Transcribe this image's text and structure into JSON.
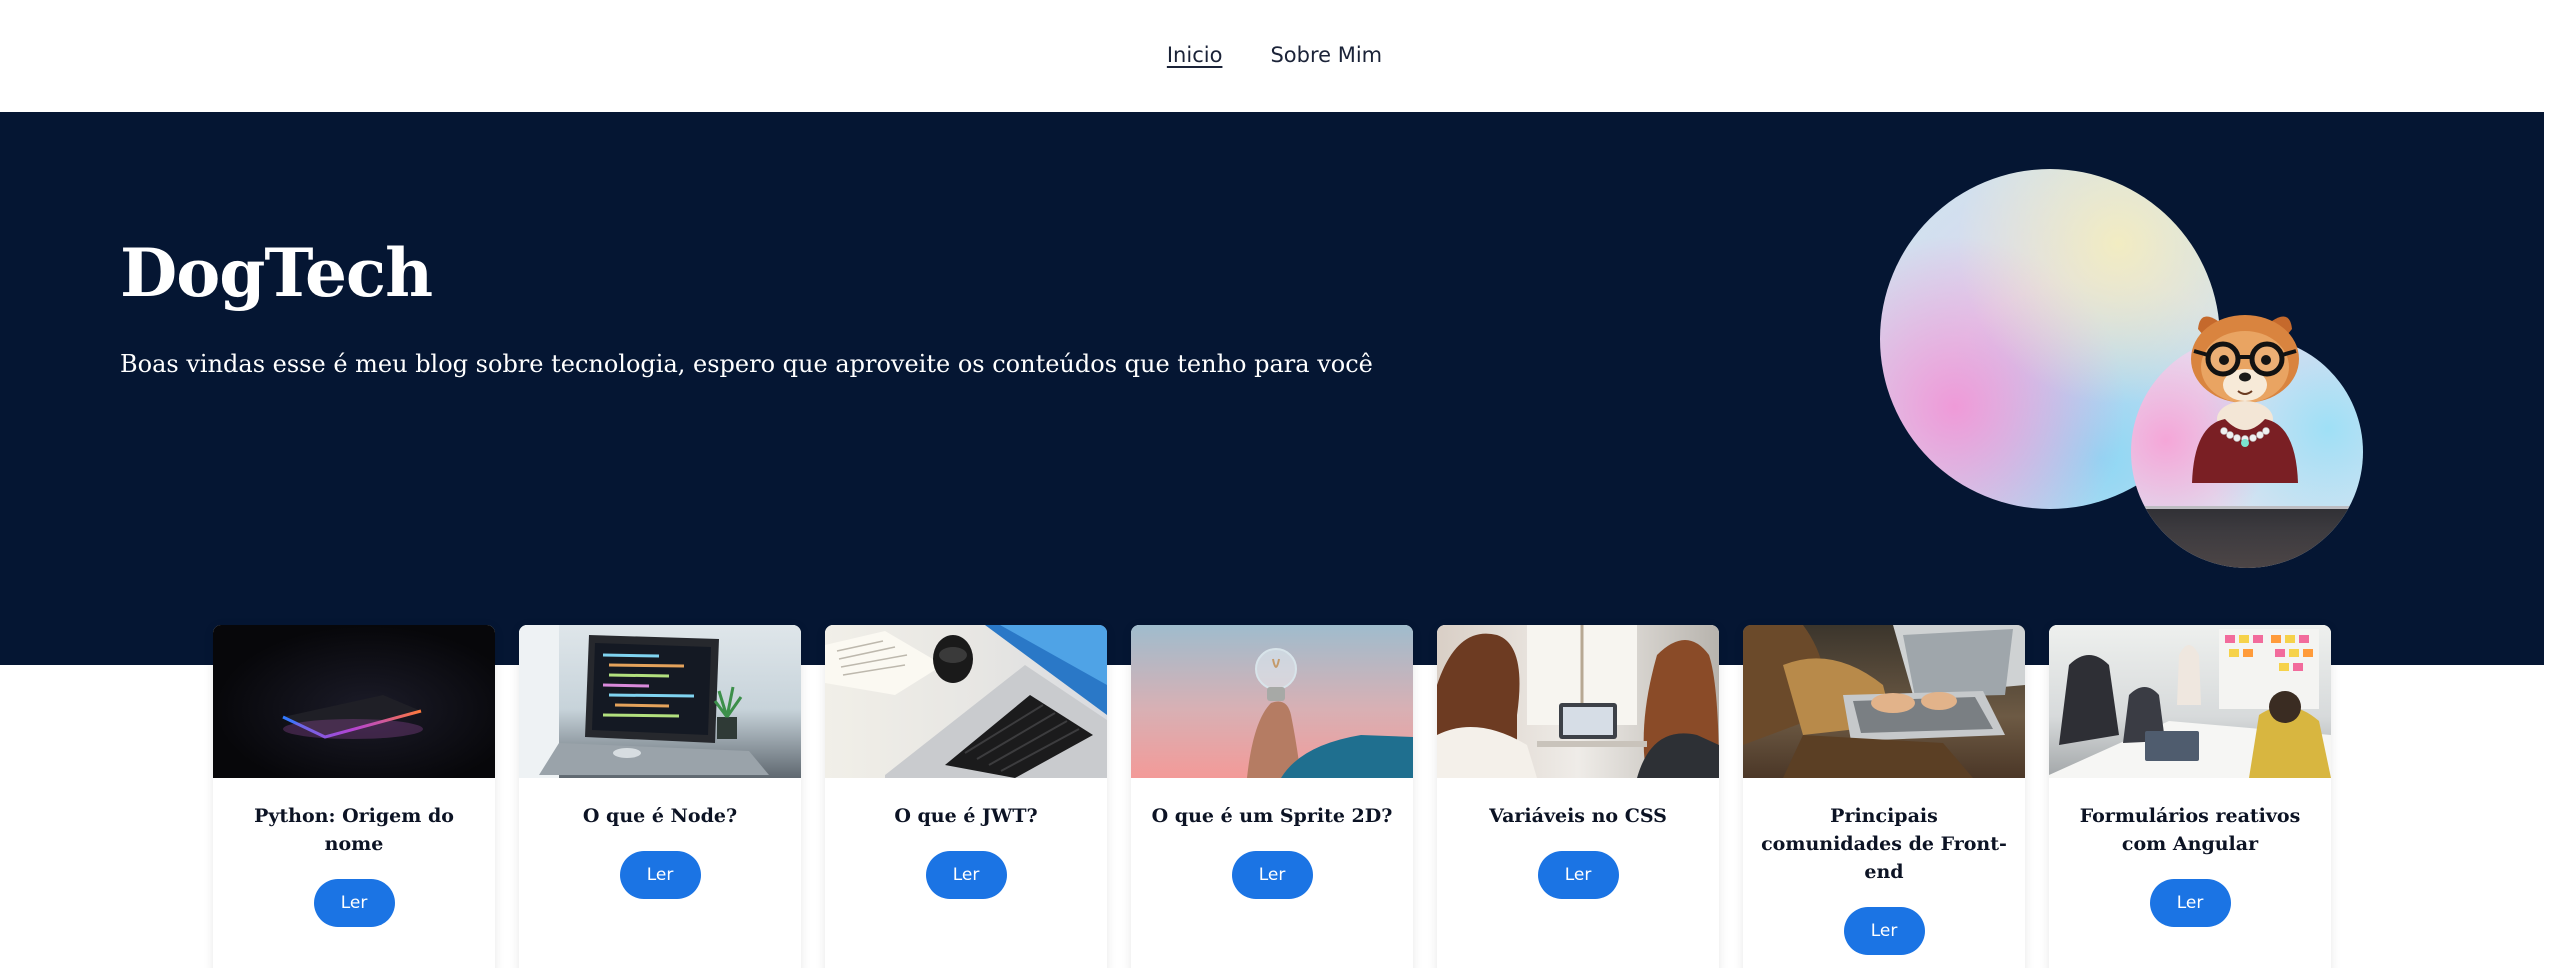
{
  "nav": {
    "items": [
      {
        "label": "Inicio",
        "active": true
      },
      {
        "label": "Sobre Mim",
        "active": false
      }
    ]
  },
  "hero": {
    "title": "DogTech",
    "subtitle": "Boas vindas esse é meu blog sobre tecnologia, espero que aproveite os conteúdos que tenho para você"
  },
  "colors": {
    "hero_background": "#051633",
    "button": "#1b74e4",
    "text_dark": "#0c1324"
  },
  "cards": [
    {
      "title": "Python: Origem do nome",
      "button": "Ler",
      "image": "laptop-neon-photo"
    },
    {
      "title": "O que é Node?",
      "button": "Ler",
      "image": "laptop-code-photo"
    },
    {
      "title": "O que é JWT?",
      "button": "Ler",
      "image": "laptop-desk-photo"
    },
    {
      "title": "O que é um Sprite 2D?",
      "button": "Ler",
      "image": "lightbulb-photo"
    },
    {
      "title": "Variáveis no CSS",
      "button": "Ler",
      "image": "women-laptop-photo"
    },
    {
      "title": "Principais comunidades de Front-end",
      "button": "Ler",
      "image": "typing-laptop-photo"
    },
    {
      "title": "Formulários reativos com Angular",
      "button": "Ler",
      "image": "team-meeting-photo"
    }
  ]
}
